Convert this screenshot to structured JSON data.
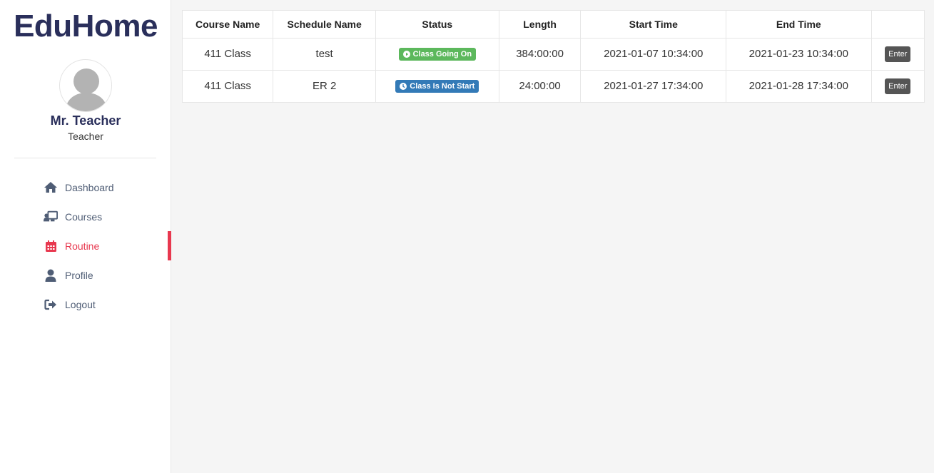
{
  "brand": {
    "title": "EduHome"
  },
  "user": {
    "name": "Mr. Teacher",
    "role": "Teacher"
  },
  "nav": [
    {
      "label": "Dashboard",
      "icon": "home-icon",
      "active": false
    },
    {
      "label": "Courses",
      "icon": "teacher-board-icon",
      "active": false
    },
    {
      "label": "Routine",
      "icon": "calendar-icon",
      "active": true
    },
    {
      "label": "Profile",
      "icon": "user-icon",
      "active": false
    },
    {
      "label": "Logout",
      "icon": "sign-out-icon",
      "active": false
    }
  ],
  "colors": {
    "accent": "#e8384f",
    "brand": "#2a2f5b",
    "going_on": "#5cb85c",
    "not_start": "#337ab7"
  },
  "table": {
    "headers": [
      "Course Name",
      "Schedule Name",
      "Status",
      "Length",
      "Start Time",
      "End Time",
      ""
    ],
    "rows": [
      {
        "course": "411 Class",
        "schedule": "test",
        "status": "Class Going On",
        "status_icon": "play-circle-icon",
        "length": "384:00:00",
        "start": "2021-01-07 10:34:00",
        "end": "2021-01-23 10:34:00",
        "action": "Enter"
      },
      {
        "course": "411 Class",
        "schedule": "ER 2",
        "status": "Class Is Not Start",
        "status_icon": "clock-icon",
        "length": "24:00:00",
        "start": "2021-01-27 17:34:00",
        "end": "2021-01-28 17:34:00",
        "action": "Enter"
      }
    ]
  }
}
